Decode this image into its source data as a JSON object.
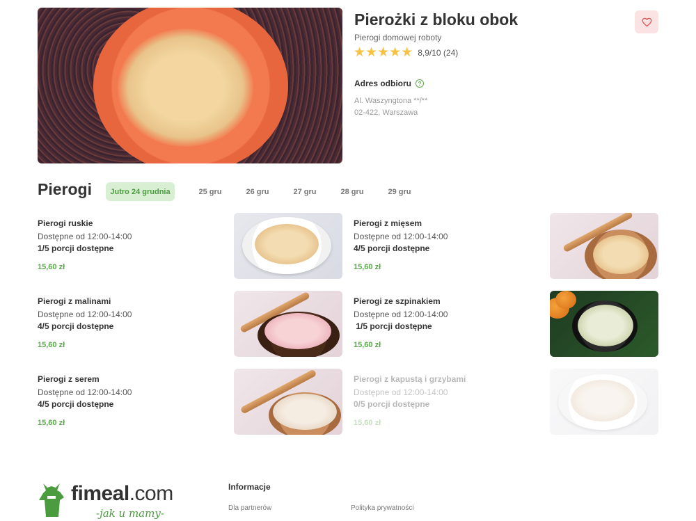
{
  "restaurant": {
    "name": "Pierożki z bloku obok",
    "subtitle": "Pierogi domowej roboty",
    "stars": 5,
    "rating_text": "8,9/10 (24)",
    "address_title": "Adres odbioru",
    "address_line1": "Al. Waszyngtona **/**",
    "address_line2": "02-422, Warszawa"
  },
  "menu": {
    "section_title": "Pierogi",
    "tabs": [
      {
        "label": "Jutro 24 grudnia",
        "active": true
      },
      {
        "label": "25 gru",
        "active": false
      },
      {
        "label": "26 gru",
        "active": false
      },
      {
        "label": "27 gru",
        "active": false
      },
      {
        "label": "28 gru",
        "active": false
      },
      {
        "label": "29 gru",
        "active": false
      }
    ],
    "items": [
      {
        "name": "Pierogi ruskie",
        "hours": "Dostępne od 12:00-14:00",
        "availability": "1/5 porcji dostępne",
        "price": "15,60 zł"
      },
      {
        "name": "Pierogi z mięsem",
        "hours": "Dostępne od 12:00-14:00",
        "availability": "4/5 porcji dostępne",
        "price": "15,60 zł"
      },
      {
        "name": "Pierogi z malinami",
        "hours": "Dostępne od 12:00-14:00",
        "availability": "4/5 porcji dostępne",
        "price": "15,60 zł"
      },
      {
        "name": "Pierogi ze szpinakiem",
        "hours": "Dostępne od 12:00-14:00",
        "availability": " 1/5 porcji dostępne",
        "price": "15,60 zł"
      },
      {
        "name": "Pierogi z serem",
        "hours": "Dostępne od 12:00-14:00",
        "availability": "4/5 porcji dostępne",
        "price": "15,60 zł"
      },
      {
        "name": "Pierogi z kapustą i grzybami",
        "hours": "Dostępne od 12:00-14:00",
        "availability": "0/5 porcji dostępne",
        "price": "15,60 zł",
        "sold_out": true
      }
    ]
  },
  "footer": {
    "logo_main": "fimeal",
    "logo_suffix": ".com",
    "logo_tagline": "-jak u mamy-",
    "info_heading": "Informacje",
    "links": [
      "Dla partnerów",
      "Polityka prywatności"
    ]
  },
  "colors": {
    "accent_green": "#5aa84a",
    "active_tab_bg": "#d8efd3",
    "favorite_bg": "#fbe3e3",
    "favorite_icon": "#e05a5a",
    "star": "#f5c242"
  },
  "icons": {
    "favorite": "heart-icon",
    "help": "question-circle-icon",
    "rating": "star-icon",
    "logo": "chef-apron-icon"
  }
}
